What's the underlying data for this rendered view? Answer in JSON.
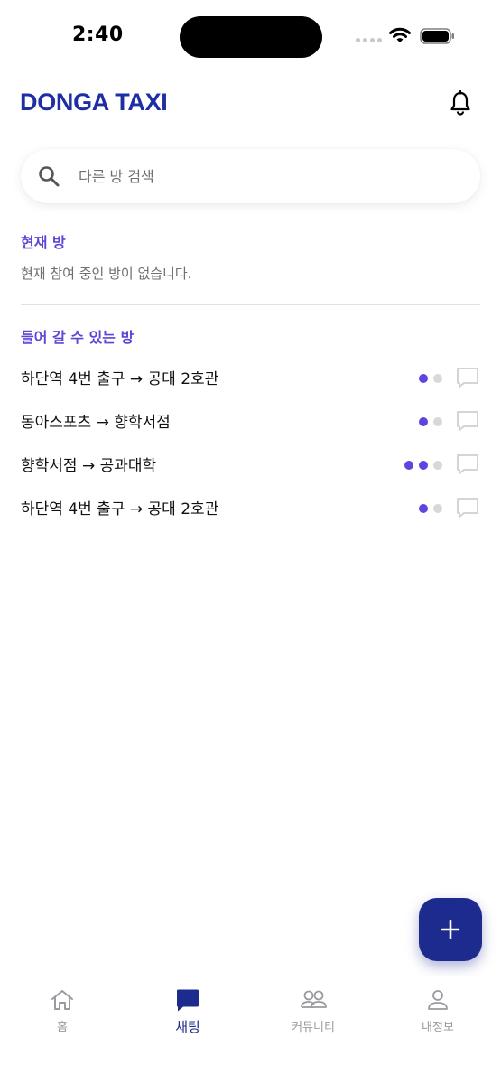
{
  "status_bar": {
    "time": "2:40"
  },
  "header": {
    "brand": "DONGA TAXI"
  },
  "search": {
    "placeholder": "다른 방 검색"
  },
  "current_room": {
    "title": "현재 방",
    "empty_text": "현재 참여 중인 방이 없습니다."
  },
  "available_rooms": {
    "title": "들어 갈 수 있는 방",
    "rooms": [
      {
        "name": "하단역 4번 출구 → 공대 2호관",
        "occupied": 1,
        "capacity": 2
      },
      {
        "name": "동아스포츠 → 향학서점",
        "occupied": 1,
        "capacity": 2
      },
      {
        "name": "향학서점 → 공과대학",
        "occupied": 2,
        "capacity": 3
      },
      {
        "name": "하단역 4번 출구 → 공대 2호관",
        "occupied": 1,
        "capacity": 2
      }
    ]
  },
  "fab": {
    "icon": "plus-icon"
  },
  "tabs": [
    {
      "label": "홈",
      "icon": "home-icon",
      "active": false
    },
    {
      "label": "채팅",
      "icon": "chat-bubble-icon",
      "active": true
    },
    {
      "label": "커뮤니티",
      "icon": "people-icon",
      "active": false
    },
    {
      "label": "내정보",
      "icon": "person-icon",
      "active": false
    }
  ],
  "colors": {
    "brand": "#1f2fa3",
    "accent": "#5b47d6",
    "fab": "#1d2b8f",
    "dot_on": "#5b47e0",
    "dot_off": "#d8d8dc"
  }
}
